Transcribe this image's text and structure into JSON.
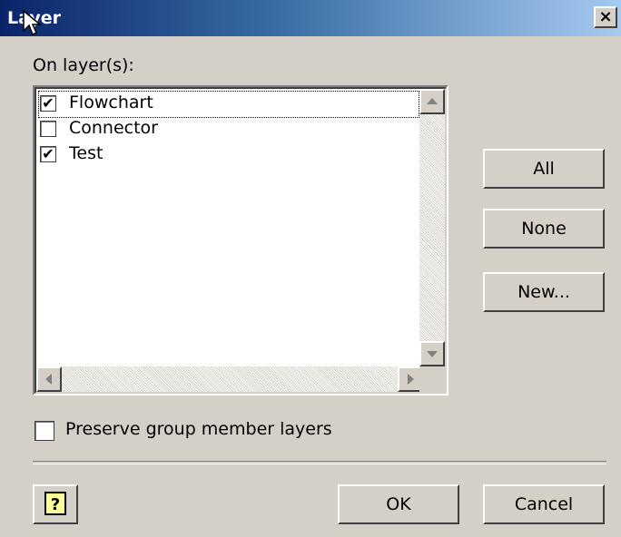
{
  "window": {
    "title": "Layer",
    "close_glyph": "×"
  },
  "section_label": "On layer(s):",
  "layers": [
    {
      "label": "Flowchart",
      "checked": true,
      "focused": true
    },
    {
      "label": "Connector",
      "checked": false,
      "focused": false
    },
    {
      "label": "Test",
      "checked": true,
      "focused": false
    }
  ],
  "side_buttons": {
    "all": "All",
    "none": "None",
    "new": "New..."
  },
  "preserve": {
    "label": "Preserve group member layers",
    "checked": false
  },
  "footer": {
    "help_glyph": "?",
    "ok": "OK",
    "cancel": "Cancel"
  }
}
